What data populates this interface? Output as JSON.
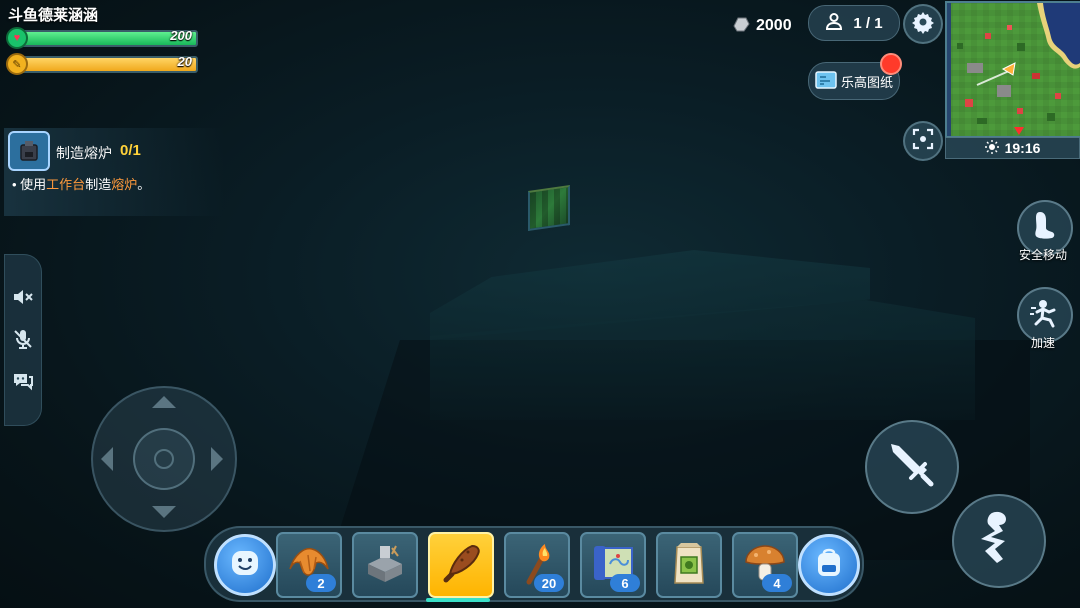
{
  "player": {
    "name": "斗鱼德莱涵涵",
    "health": {
      "value": "200",
      "fill": 1.0
    },
    "hunger": {
      "value": "20",
      "fill": 1.0
    }
  },
  "quest": {
    "title": "制造熔炉",
    "progress": "0/1",
    "desc_prefix": "• 使用",
    "desc_hl1": "工作台",
    "desc_mid": "制造",
    "desc_hl2": "熔炉",
    "desc_suffix": "。"
  },
  "topbar": {
    "coins": "2000",
    "players": "1 / 1",
    "blueprint_label": "乐高图纸"
  },
  "minimap": {
    "time": "19:16"
  },
  "actions": {
    "safe_move_label": "安全移动",
    "sprint_label": "加速"
  },
  "hotbar": {
    "slots": [
      {
        "icon": "croissant-icon",
        "count": "2"
      },
      {
        "icon": "crafting-table-icon",
        "count": ""
      },
      {
        "icon": "wooden-club-icon",
        "count": "",
        "selected": true
      },
      {
        "icon": "torch-icon",
        "count": "20"
      },
      {
        "icon": "map-scroll-icon",
        "count": "6"
      },
      {
        "icon": "seed-bag-icon",
        "count": ""
      },
      {
        "icon": "mushroom-icon",
        "count": "4"
      }
    ]
  },
  "colors": {
    "health": "#18b85a",
    "hunger": "#f0a81c",
    "selected_slot": "#ffc61a",
    "count_badge": "#2f7fd8",
    "quest_highlight": "#ff9a3c",
    "quest_progress": "#ffd23a"
  }
}
